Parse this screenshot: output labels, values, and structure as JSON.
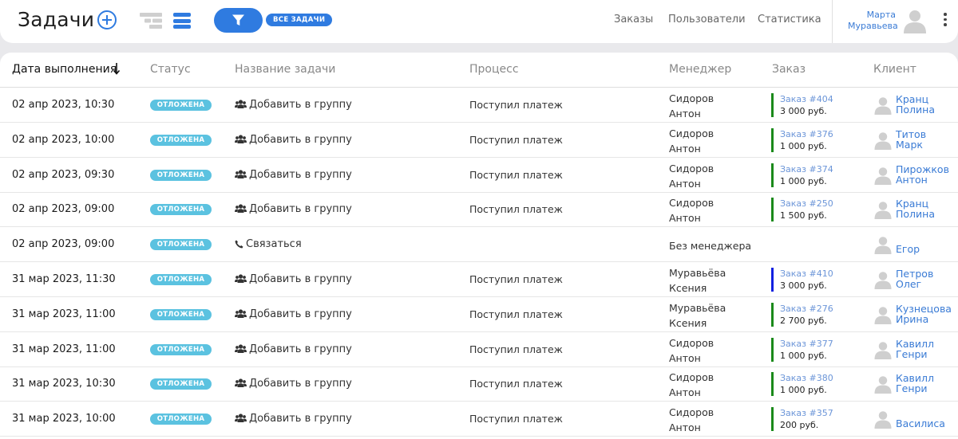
{
  "header": {
    "title": "Задачи",
    "filter_tag": "ВСЕ ЗАДАЧИ",
    "nav": [
      {
        "label": "Заказы"
      },
      {
        "label": "Пользователи"
      },
      {
        "label": "Статистика"
      }
    ],
    "user": {
      "first_name": "Марта",
      "last_name": "Муравьева"
    },
    "icons": {
      "add": "plus-circle-icon",
      "tree_view": "tree-view-icon",
      "list_view": "list-view-icon",
      "filter": "funnel-icon",
      "avatar": "user-avatar-icon",
      "menu": "kebab-menu-icon"
    }
  },
  "table": {
    "columns": [
      {
        "key": "date",
        "label": "Дата выполнения"
      },
      {
        "key": "status",
        "label": "Статус"
      },
      {
        "key": "task",
        "label": "Название задачи"
      },
      {
        "key": "process",
        "label": "Процесс"
      },
      {
        "key": "manager",
        "label": "Менеджер"
      },
      {
        "key": "order",
        "label": "Заказ"
      },
      {
        "key": "client",
        "label": "Клиент"
      }
    ],
    "rows": [
      {
        "date": "02 апр 2023, 10:30",
        "status": "ОТЛОЖЕНА",
        "task_icon": "users-icon",
        "task": "Добавить в группу",
        "process": "Поступил платеж",
        "manager1": "Сидоров",
        "manager2": "Антон",
        "order": "Заказ #404",
        "sum": "3 000 руб.",
        "order_color": "green",
        "client1": "Кранц",
        "client2": "Полина"
      },
      {
        "date": "02 апр 2023, 10:00",
        "status": "ОТЛОЖЕНА",
        "task_icon": "users-icon",
        "task": "Добавить в группу",
        "process": "Поступил платеж",
        "manager1": "Сидоров",
        "manager2": "Антон",
        "order": "Заказ #376",
        "sum": "1 000 руб.",
        "order_color": "green",
        "client1": "Титов",
        "client2": "Марк"
      },
      {
        "date": "02 апр 2023, 09:30",
        "status": "ОТЛОЖЕНА",
        "task_icon": "users-icon",
        "task": "Добавить в группу",
        "process": "Поступил платеж",
        "manager1": "Сидоров",
        "manager2": "Антон",
        "order": "Заказ #374",
        "sum": "1 000 руб.",
        "order_color": "green",
        "client1": "Пирожков",
        "client2": "Антон"
      },
      {
        "date": "02 апр 2023, 09:00",
        "status": "ОТЛОЖЕНА",
        "task_icon": "users-icon",
        "task": "Добавить в группу",
        "process": "Поступил платеж",
        "manager1": "Сидоров",
        "manager2": "Антон",
        "order": "Заказ #250",
        "sum": "1 500 руб.",
        "order_color": "green",
        "client1": "Кранц",
        "client2": "Полина"
      },
      {
        "date": "02 апр 2023, 09:00",
        "status": "ОТЛОЖЕНА",
        "task_icon": "phone-icon",
        "task": "Связаться",
        "process": "",
        "manager1": "Без менеджера",
        "manager2": "",
        "order": "",
        "sum": "",
        "order_color": "",
        "client1": "Егор",
        "client2": ""
      },
      {
        "date": "31 мар 2023, 11:30",
        "status": "ОТЛОЖЕНА",
        "task_icon": "users-icon",
        "task": "Добавить в группу",
        "process": "Поступил платеж",
        "manager1": "Муравьёва",
        "manager2": "Ксения",
        "order": "Заказ #410",
        "sum": "3 000 руб.",
        "order_color": "blue",
        "client1": "Петров",
        "client2": "Олег"
      },
      {
        "date": "31 мар 2023, 11:00",
        "status": "ОТЛОЖЕНА",
        "task_icon": "users-icon",
        "task": "Добавить в группу",
        "process": "Поступил платеж",
        "manager1": "Муравьёва",
        "manager2": "Ксения",
        "order": "Заказ #276",
        "sum": "2 700 руб.",
        "order_color": "green",
        "client1": "Кузнецова",
        "client2": "Ирина"
      },
      {
        "date": "31 мар 2023, 11:00",
        "status": "ОТЛОЖЕНА",
        "task_icon": "users-icon",
        "task": "Добавить в группу",
        "process": "Поступил платеж",
        "manager1": "Сидоров",
        "manager2": "Антон",
        "order": "Заказ #377",
        "sum": "1 000 руб.",
        "order_color": "green",
        "client1": "Кавилл",
        "client2": "Генри"
      },
      {
        "date": "31 мар 2023, 10:30",
        "status": "ОТЛОЖЕНА",
        "task_icon": "users-icon",
        "task": "Добавить в группу",
        "process": "Поступил платеж",
        "manager1": "Сидоров",
        "manager2": "Антон",
        "order": "Заказ #380",
        "sum": "1 000 руб.",
        "order_color": "green",
        "client1": "Кавилл",
        "client2": "Генри"
      },
      {
        "date": "31 мар 2023, 10:00",
        "status": "ОТЛОЖЕНА",
        "task_icon": "users-icon",
        "task": "Добавить в группу",
        "process": "Поступил платеж",
        "manager1": "Сидоров",
        "manager2": "Антон",
        "order": "Заказ #357",
        "sum": "200 руб.",
        "order_color": "green",
        "client1": "Василиса",
        "client2": ""
      }
    ]
  }
}
